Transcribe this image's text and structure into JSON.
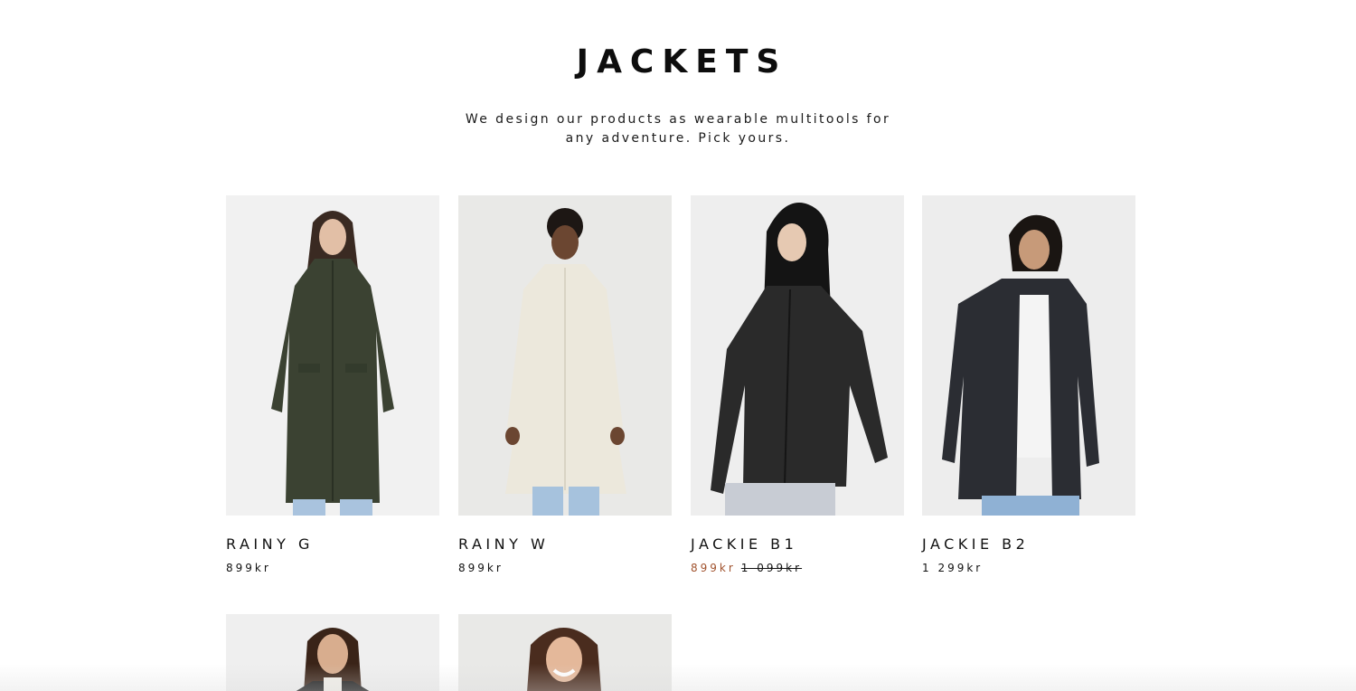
{
  "header": {
    "title": "JACKETS",
    "subtitle": "We design our products as wearable multitools for any adventure. Pick yours."
  },
  "products": [
    {
      "name": "RAINY G",
      "price": "899kr",
      "coat_color": "#3b4232",
      "bg": "#f1f1f1"
    },
    {
      "name": "RAINY W",
      "price": "899kr",
      "coat_color": "#ece8dc",
      "bg": "#e9e9e7"
    },
    {
      "name": "JACKIE B1",
      "sale_price": "899kr",
      "old_price": "1 099kr",
      "coat_color": "#2a2a2a",
      "bg": "#eeeeee"
    },
    {
      "name": "JACKIE B2",
      "price": "1 299kr",
      "coat_color": "#2b2d33",
      "bg": "#ededed"
    }
  ],
  "more_products": [
    {
      "bg": "#efefef"
    },
    {
      "bg": "#e9e9e7"
    }
  ],
  "colors": {
    "sale": "#a0522d",
    "text": "#111111"
  }
}
